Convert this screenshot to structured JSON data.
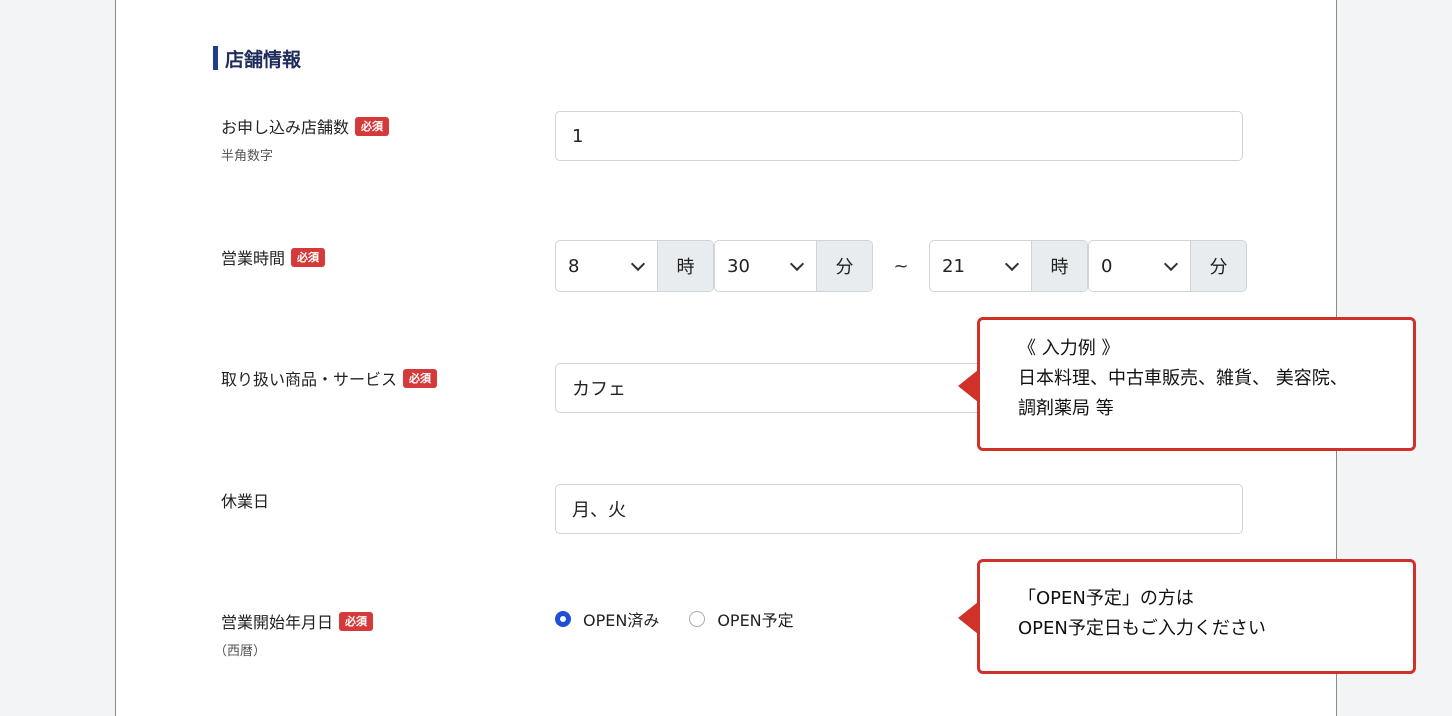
{
  "section": {
    "title": "店舗情報"
  },
  "required_badge": "必須",
  "fields": {
    "store_count": {
      "label": "お申し込み店舗数",
      "sublabel": "半角数字",
      "value": "1"
    },
    "hours": {
      "label": "営業時間",
      "start_hour": "8",
      "hour_unit": "時",
      "start_min": "30",
      "min_unit": "分",
      "separator": "~",
      "end_hour": "21",
      "end_min": "0"
    },
    "products": {
      "label": "取り扱い商品・サービス",
      "value": "カフェ"
    },
    "holidays": {
      "label": "休業日",
      "value": "月、火"
    },
    "open_date": {
      "label": "営業開始年月日",
      "sublabel": "（西暦）",
      "options": [
        "OPEN済み",
        "OPEN予定"
      ],
      "selected": "OPEN済み"
    }
  },
  "callouts": {
    "products_example": {
      "line1": "《 入力例 》",
      "line2": "日本料理、中古車販売、雑貨、 美容院、",
      "line3": "調剤薬局 等"
    },
    "open_note": {
      "line1": "「OPEN予定」の方は",
      "line2": "OPEN予定日もご入力ください"
    }
  },
  "colors": {
    "accent": "#1f3d8f",
    "required": "#d43a3a",
    "callout_border": "#d0322a",
    "radio_selected": "#1f4fd8"
  }
}
